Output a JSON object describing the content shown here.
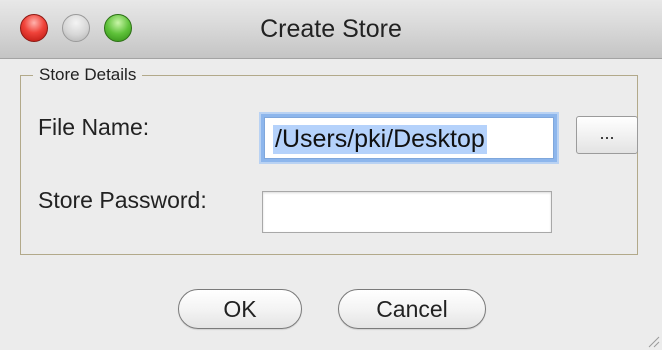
{
  "window": {
    "title": "Create Store"
  },
  "store_details": {
    "legend": "Store Details",
    "file_name_label": "File Name:",
    "file_name_value": "/Users/pki/Desktop",
    "browse_label": "...",
    "password_label": "Store Password:",
    "password_value": ""
  },
  "buttons": {
    "ok_label": "OK",
    "cancel_label": "Cancel"
  },
  "icons": {
    "close": "close-icon",
    "minimize": "minimize-icon",
    "zoom": "zoom-icon",
    "resize": "resize-grip-icon"
  },
  "colors": {
    "close": "#f0433a",
    "minimize": "#d6d6d6",
    "zoom": "#5fc23a",
    "focus_ring": "#8db6ec",
    "selection": "#b5d2fb"
  }
}
